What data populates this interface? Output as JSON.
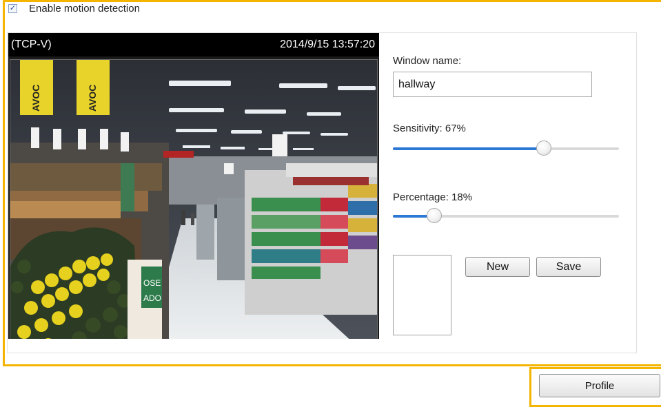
{
  "motion": {
    "enable_label": "Enable motion detection",
    "enabled": true
  },
  "video": {
    "stream_label": "(TCP-V)",
    "timestamp": "2014/9/15 13:57:20"
  },
  "window": {
    "name_label": "Window name:",
    "name_value": "hallway"
  },
  "sensitivity": {
    "label": "Sensitivity: 67%",
    "value": 67
  },
  "percentage": {
    "label": "Percentage: 18%",
    "value": 18
  },
  "buttons": {
    "new_label": "New",
    "save_label": "Save",
    "profile_label": "Profile"
  },
  "colors": {
    "highlight": "#f4b400",
    "slider_fill": "#2b79d4"
  }
}
